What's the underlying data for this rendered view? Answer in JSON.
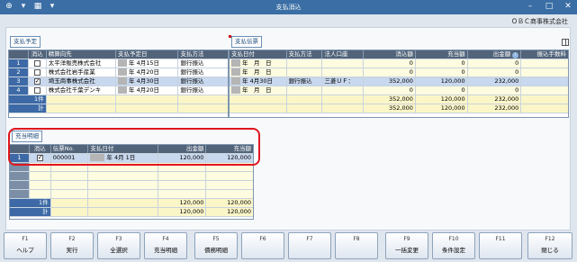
{
  "window": {
    "title": "支払消込",
    "company": "ＯＢＣ商事株式会社"
  },
  "titlebar_icons": [
    "add-icon",
    "dropdown-icon",
    "layout-icon",
    "dropdown-icon"
  ],
  "sections": {
    "payment_schedule": "支払予定",
    "payment_slip": "支払伝票",
    "detail": "充当明細"
  },
  "schedule": {
    "headers": [
      "消込",
      "精算向先",
      "支払予定日",
      "支払方法"
    ],
    "rows": [
      {
        "no": "1",
        "checked": false,
        "partner": "太平洋販売株式会社",
        "date": "年 4月15日",
        "method": "銀行振込"
      },
      {
        "no": "2",
        "checked": false,
        "partner": "株式会社岩手産業",
        "date": "年 4月20日",
        "method": "銀行振込"
      },
      {
        "no": "3",
        "checked": true,
        "partner": "埼玉商事株式会社",
        "date": "年 4月30日",
        "method": "銀行振込"
      },
      {
        "no": "4",
        "checked": false,
        "partner": "株式会社千葉デンキ",
        "date": "年 4月20日",
        "method": "銀行振込"
      }
    ],
    "count_label": "1件",
    "total_label": "計"
  },
  "slip": {
    "headers": [
      "支払日付",
      "支払方法",
      "法人口座",
      "消込額",
      "充当額",
      "出金額",
      "振込手数料"
    ],
    "rows": [
      {
        "date": "年　月　日",
        "method": "",
        "account": "",
        "consumed": "0",
        "applied": "0",
        "payment": "0",
        "fee": ""
      },
      {
        "date": "年　月　日",
        "method": "",
        "account": "",
        "consumed": "0",
        "applied": "0",
        "payment": "0",
        "fee": ""
      },
      {
        "date": "年 4月30日",
        "method": "銀行振込",
        "account": "三菱ＵＦ：",
        "consumed": "352,000",
        "applied": "120,000",
        "payment": "232,000",
        "fee": ""
      },
      {
        "date": "年　月　日",
        "method": "",
        "account": "",
        "consumed": "0",
        "applied": "0",
        "payment": "0",
        "fee": ""
      }
    ],
    "count_row": {
      "consumed": "352,000",
      "applied": "120,000",
      "payment": "232,000"
    },
    "total_row": {
      "consumed": "352,000",
      "applied": "120,000",
      "payment": "232,000"
    }
  },
  "detail": {
    "headers": [
      "消込",
      "伝票No.",
      "支払日付",
      "出金額",
      "充当額"
    ],
    "row": {
      "no": "1",
      "checked": true,
      "slip_no": "000001",
      "date": "年  4月  1日",
      "payment": "120,000",
      "applied": "120,000"
    },
    "count_label": "1件",
    "total_label": "計",
    "count_row": {
      "payment": "120,000",
      "applied": "120,000"
    },
    "total_row": {
      "payment": "120,000",
      "applied": "120,000"
    }
  },
  "fkeys": [
    {
      "key": "F1",
      "label": "ヘルプ",
      "enabled": true
    },
    {
      "key": "F2",
      "label": "実行",
      "enabled": true
    },
    {
      "key": "F3",
      "label": "全選択",
      "enabled": true
    },
    {
      "key": "F4",
      "label": "充当明細",
      "enabled": true
    },
    {
      "key": "F5",
      "label": "債務明細",
      "enabled": true
    },
    {
      "key": "F6",
      "label": "",
      "enabled": false
    },
    {
      "key": "F7",
      "label": "",
      "enabled": false
    },
    {
      "key": "F8",
      "label": "",
      "enabled": false
    },
    {
      "key": "F9",
      "label": "一括変更",
      "enabled": true
    },
    {
      "key": "F10",
      "label": "条件設定",
      "enabled": true
    },
    {
      "key": "F11",
      "label": "",
      "enabled": false
    },
    {
      "key": "F12",
      "label": "閉じる",
      "enabled": true
    }
  ]
}
